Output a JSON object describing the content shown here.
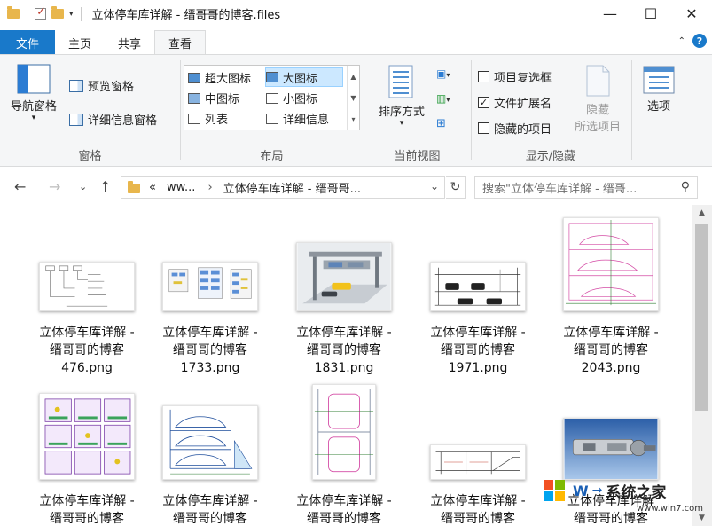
{
  "window": {
    "title": "立体停车库详解 - 缙哥哥的博客.files",
    "minimize": "—",
    "maximize": "☐",
    "close": "✕"
  },
  "tabs": [
    {
      "label": "文件"
    },
    {
      "label": "主页"
    },
    {
      "label": "共享"
    },
    {
      "label": "查看"
    }
  ],
  "ribbon": {
    "panes": {
      "label": "窗格",
      "nav_pane": "导航窗格",
      "preview_pane": "预览窗格",
      "details_pane": "详细信息窗格"
    },
    "layout": {
      "label": "布局",
      "items": [
        "超大图标",
        "大图标",
        "中图标",
        "小图标",
        "列表",
        "详细信息"
      ],
      "selected": "大图标"
    },
    "current_view": {
      "label": "当前视图",
      "sort_by": "排序方式"
    },
    "show_hide": {
      "label": "显示/隐藏",
      "item_checkboxes": {
        "label": "项目复选框",
        "checked": false
      },
      "file_extensions": {
        "label": "文件扩展名",
        "checked": true
      },
      "hidden_items": {
        "label": "隐藏的项目",
        "checked": false
      },
      "hide_selected_line1": "隐藏",
      "hide_selected_line2": "所选项目"
    },
    "options": "选项"
  },
  "address": {
    "prefix": "«",
    "crumbs": [
      "ww...",
      "立体停车库详解 - 缙哥哥..."
    ],
    "search_placeholder": "搜索\"立体停车库详解 - 缙哥..."
  },
  "files": [
    {
      "line1": "立体停车库详解 -",
      "line2": "缙哥哥的博客",
      "line3": "476.png"
    },
    {
      "line1": "立体停车库详解 -",
      "line2": "缙哥哥的博客",
      "line3": "1733.png"
    },
    {
      "line1": "立体停车库详解 -",
      "line2": "缙哥哥的博客",
      "line3": "1831.png"
    },
    {
      "line1": "立体停车库详解 -",
      "line2": "缙哥哥的博客",
      "line3": "1971.png"
    },
    {
      "line1": "立体停车库详解 -",
      "line2": "缙哥哥的博客",
      "line3": "2043.png"
    },
    {
      "line1": "立体停车库详解 -",
      "line2": "缙哥哥的博客",
      "line3": ""
    },
    {
      "line1": "立体停车库详解 -",
      "line2": "缙哥哥的博客",
      "line3": ""
    },
    {
      "line1": "立体停车库详解 -",
      "line2": "缙哥哥的博客",
      "line3": ""
    },
    {
      "line1": "立体停车库详解 -",
      "line2": "缙哥哥的博客",
      "line3": ""
    },
    {
      "line1": "立体停车库详解",
      "line2": "缙哥哥的博客",
      "line3": ""
    }
  ],
  "watermark": {
    "text": "系统之家",
    "url": "www.win7.com"
  },
  "colors": {
    "accent": "#1979ca",
    "selection": "#cce8ff"
  }
}
